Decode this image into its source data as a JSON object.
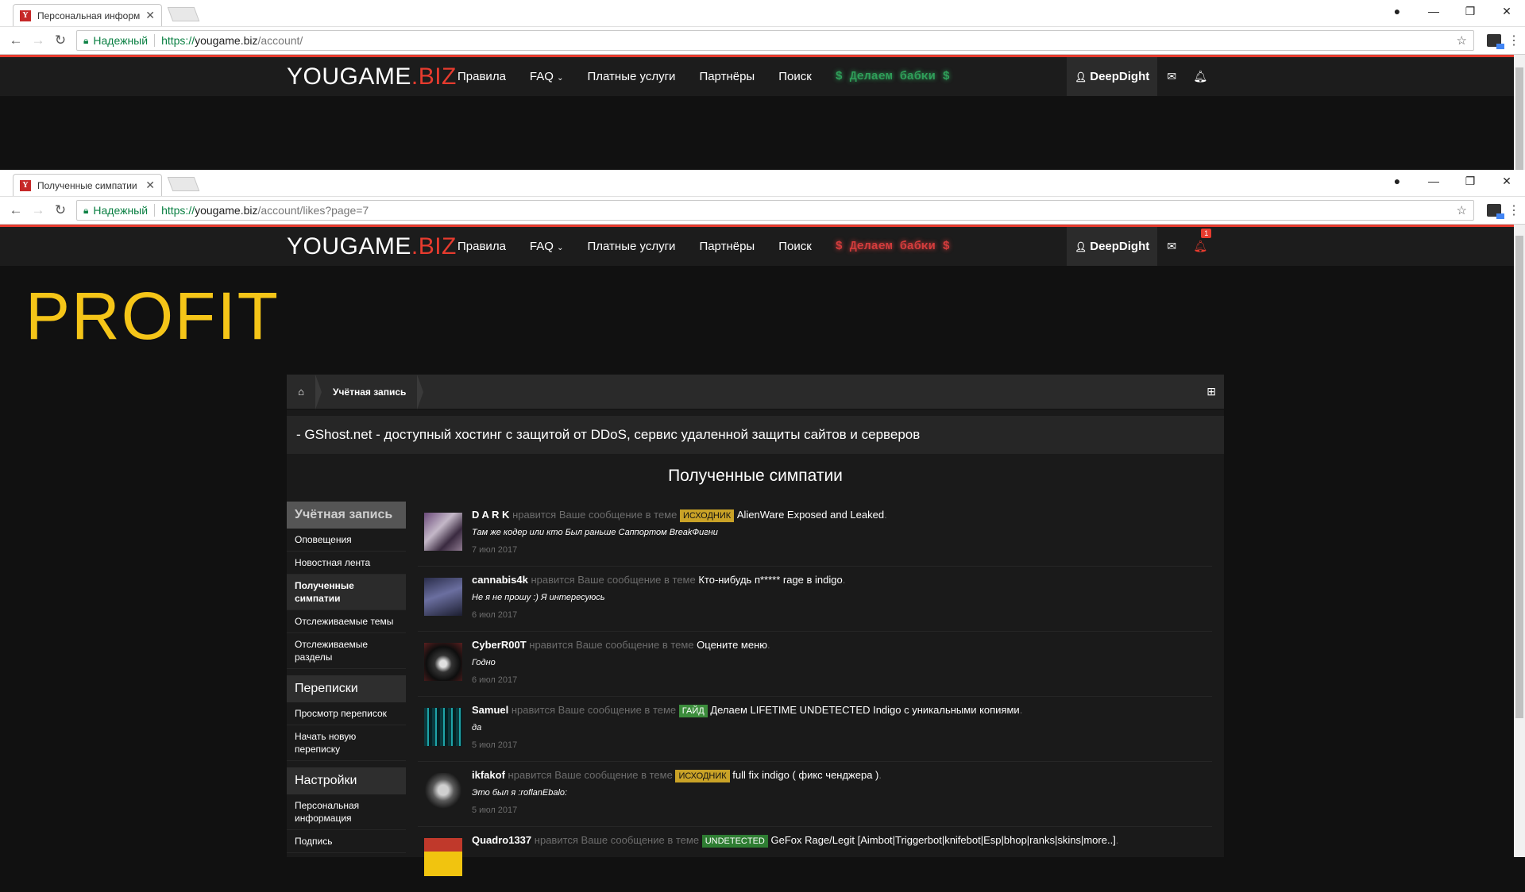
{
  "window1": {
    "tab_title": "Персональная информ",
    "secure_label": "Надежный",
    "url_scheme": "https://",
    "url_host": "yougame.biz",
    "url_path": "/account/"
  },
  "window2": {
    "tab_title": "Полученные симпатии",
    "secure_label": "Надежный",
    "url_scheme": "https://",
    "url_host": "yougame.biz",
    "url_path": "/account/likes?page=7"
  },
  "site": {
    "logo_main": "YOUGAME",
    "logo_suffix": ".BIZ",
    "nav": [
      "Правила",
      "FAQ",
      "Платные услуги",
      "Партнёры",
      "Поиск"
    ],
    "faq_chevron": "chevron-down-icon",
    "promo": "$ Делаем бабки $",
    "promo_color_win1": "#2f9e59",
    "promo_color_win2": "#d33c3c",
    "username": "DeepDight",
    "notif_count": "1",
    "accent": "#e63b2e"
  },
  "overlay": {
    "profit_text": "PROFIT",
    "color": "#f5c518"
  },
  "breadcrumb": {
    "item": "Учётная запись"
  },
  "banner": {
    "text": "- GShost.net - доступный хостинг с защитой от DDoS, сервис удаленной защиты сайтов и серверов"
  },
  "page": {
    "title": "Полученные симпатии"
  },
  "sidebar": {
    "account_head": "Учётная запись",
    "account_items": [
      "Оповещения",
      "Новостная лента",
      "Полученные симпатии",
      "Отслеживаемые темы",
      "Отслеживаемые разделы"
    ],
    "conv_head": "Переписки",
    "conv_items": [
      "Просмотр переписок",
      "Начать новую переписку"
    ],
    "settings_head": "Настройки",
    "settings_items": [
      "Персональная информация",
      "Подпись"
    ]
  },
  "likes": [
    {
      "user": "D A R K",
      "action": "нравится Ваше сообщение в теме",
      "tag": "ИСХОДНИК",
      "tag_color": "#c9a227",
      "thread": "AlienWare Exposed and Leaked",
      "quote": "Там же кодер или кто Был раньше Саппортом BreakФигни",
      "date": "7 июл 2017"
    },
    {
      "user": "cannabis4k",
      "action": "нравится Ваше сообщение в теме",
      "tag": "",
      "tag_color": "",
      "thread": "Кто-нибудь п***** rage в indigo",
      "quote": "Не я не прошу :) Я интересуюсь",
      "date": "6 июл 2017"
    },
    {
      "user": "CyberR00T",
      "action": "нравится Ваше сообщение в теме",
      "tag": "",
      "tag_color": "",
      "thread": "Оцените меню",
      "quote": "Годно",
      "date": "6 июл 2017"
    },
    {
      "user": "Samuel",
      "action": "нравится Ваше сообщение в теме",
      "tag": "ГАЙД",
      "tag_color": "#3c8d3c",
      "thread": "Делаем LIFETIME UNDETECTED Indigo с уникальными копиями",
      "quote": "да",
      "date": "5 июл 2017"
    },
    {
      "user": "ikfakof",
      "action": "нравится Ваше сообщение в теме",
      "tag": "ИСХОДНИК",
      "tag_color": "#c9a227",
      "thread": "full fix indigo ( фикс ченджера )",
      "quote": "Это был я :roflanEbalo:",
      "date": "5 июл 2017"
    },
    {
      "user": "Quadro1337",
      "action": "нравится Ваше сообщение в теме",
      "tag": "UNDETECTED",
      "tag_color": "#2e7d32",
      "thread": "GeFox Rage/Legit [Aimbot|Triggerbot|knifebot|Esp|bhop|ranks|skins|more..]",
      "quote": "",
      "date": ""
    }
  ]
}
